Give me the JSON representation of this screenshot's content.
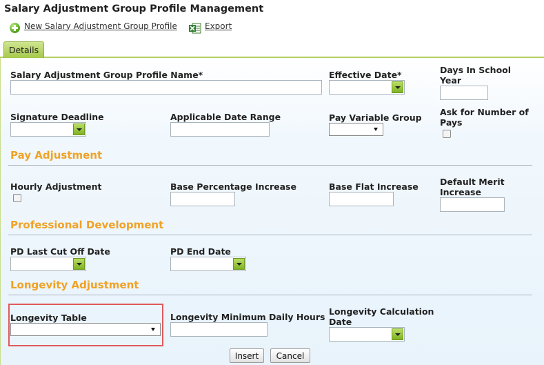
{
  "page": {
    "title": "Salary Adjustment Group Profile Management"
  },
  "toolbar": {
    "new_label": "New Salary Adjustment Group Profile",
    "export_label": "Export"
  },
  "tabs": {
    "details": "Details"
  },
  "fields": {
    "profile_name": "Salary Adjustment Group Profile Name*",
    "effective_date": "Effective Date*",
    "days_in_school_year": "Days In School Year",
    "signature_deadline": "Signature Deadline",
    "applicable_date_range": "Applicable Date Range",
    "pay_variable_group": "Pay Variable Group",
    "ask_number_of_pays": "Ask for Number of Pays",
    "hourly_adjustment": "Hourly Adjustment",
    "base_percentage_increase": "Base Percentage Increase",
    "base_flat_increase": "Base Flat Increase",
    "default_merit_increase": "Default Merit Increase",
    "pd_last_cut_off_date": "PD Last Cut Off Date",
    "pd_end_date": "PD End Date",
    "longevity_table": "Longevity Table",
    "longevity_min_daily_hours": "Longevity Minimum Daily Hours",
    "longevity_calc_date": "Longevity Calculation Date"
  },
  "sections": {
    "pay_adjustment": "Pay Adjustment",
    "professional_development": "Professional Development",
    "longevity_adjustment": "Longevity Adjustment"
  },
  "buttons": {
    "insert": "Insert",
    "cancel": "Cancel"
  },
  "colors": {
    "section_heading": "#f0a227",
    "tab_green": "#b4cf62",
    "highlight_border": "#e05a5a"
  }
}
